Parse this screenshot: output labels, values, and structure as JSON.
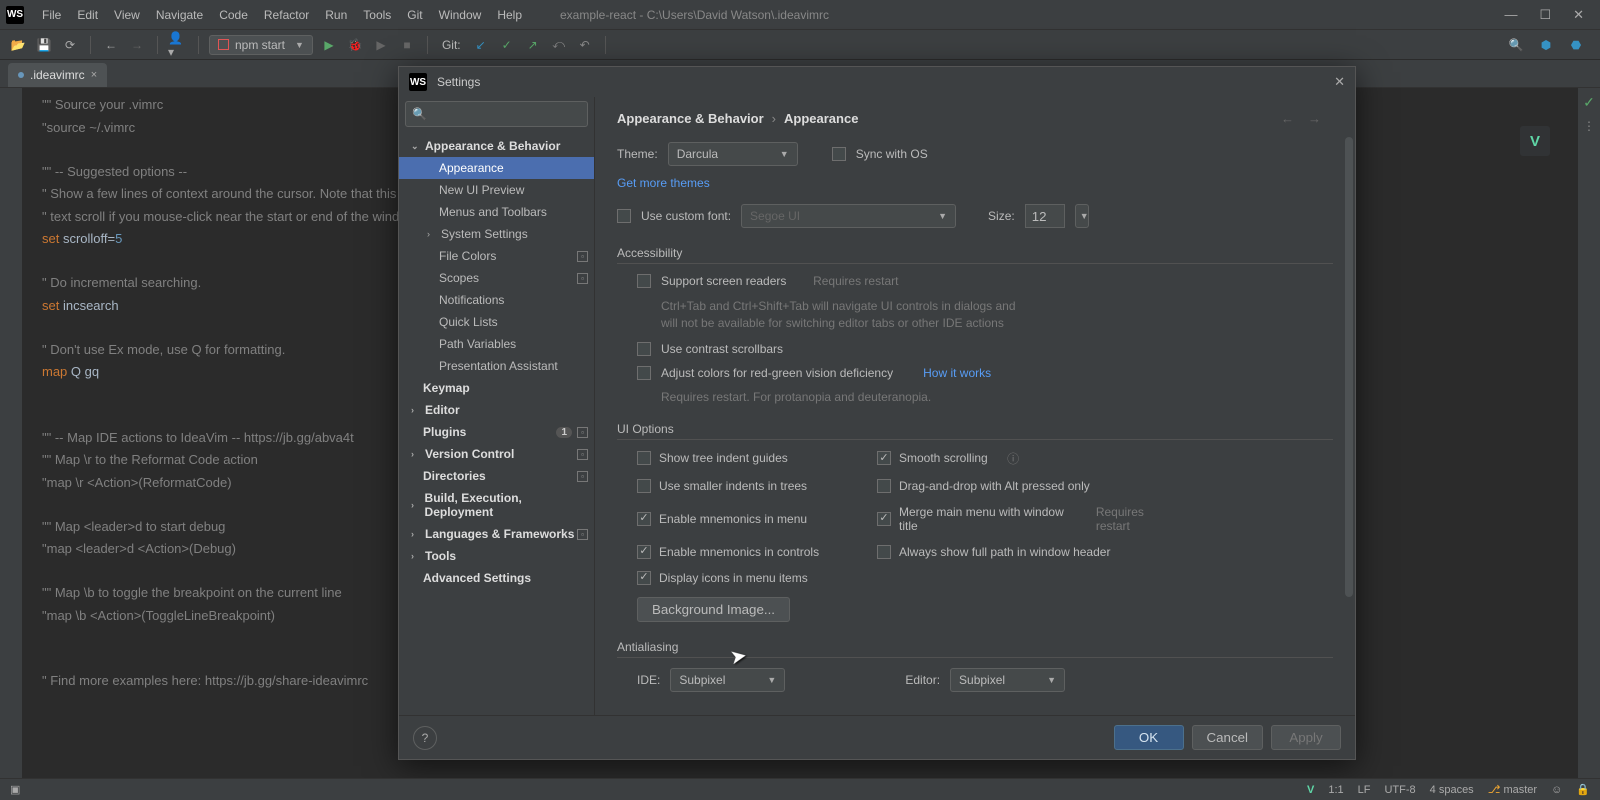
{
  "title": {
    "project": "example-react",
    "path": "C:\\Users\\David Watson\\.ideavimrc"
  },
  "menu": [
    "File",
    "Edit",
    "View",
    "Navigate",
    "Code",
    "Refactor",
    "Run",
    "Tools",
    "Git",
    "Window",
    "Help"
  ],
  "runconfig": "npm start",
  "git_label": "Git:",
  "tab_name": ".ideavimrc",
  "code": {
    "l1": "\"\" Source your .vimrc",
    "l2": "\"source ~/.vimrc",
    "l3": "\"\" -- Suggested options --",
    "l4": "\" Show a few lines of context around the cursor. Note that this makes the",
    "l5": "\" text scroll if you mouse-click near the start or end of the window.",
    "l6a": "set",
    "l6b": " scrolloff=",
    "l6c": "5",
    "l7": "\" Do incremental searching.",
    "l8a": "set",
    "l8b": " incsearch",
    "l9": "\" Don't use Ex mode, use Q for formatting.",
    "l10a": "map ",
    "l10b": "Q gq",
    "l11": "\"\" -- Map IDE actions to IdeaVim -- https://jb.gg/abva4t",
    "l12": "\"\" Map \\r to the Reformat Code action",
    "l13": "\"map \\r <Action>(ReformatCode)",
    "l14": "\"\" Map <leader>d to start debug",
    "l15": "\"map <leader>d <Action>(Debug)",
    "l16": "\"\" Map \\b to toggle the breakpoint on the current line",
    "l17": "\"map \\b <Action>(ToggleLineBreakpoint)",
    "l18": "\" Find more examples here: https://jb.gg/share-ideavimrc"
  },
  "dialog": {
    "title": "Settings",
    "tree": {
      "appearance_behavior": "Appearance & Behavior",
      "appearance": "Appearance",
      "new_ui": "New UI Preview",
      "menus": "Menus and Toolbars",
      "system": "System Settings",
      "file_colors": "File Colors",
      "scopes": "Scopes",
      "notifications": "Notifications",
      "quick_lists": "Quick Lists",
      "path_vars": "Path Variables",
      "presentation": "Presentation Assistant",
      "keymap": "Keymap",
      "editor": "Editor",
      "plugins": "Plugins",
      "vc": "Version Control",
      "dirs": "Directories",
      "build": "Build, Execution, Deployment",
      "lang": "Languages & Frameworks",
      "tools": "Tools",
      "advanced": "Advanced Settings",
      "plugin_count": "1"
    },
    "breadcrumb": {
      "a": "Appearance & Behavior",
      "b": "Appearance"
    },
    "theme_label": "Theme:",
    "theme_value": "Darcula",
    "sync_os": "Sync with OS",
    "more_themes": "Get more themes",
    "custom_font_label": "Use custom font:",
    "custom_font_value": "Segoe UI",
    "size_label": "Size:",
    "size_value": "12",
    "accessibility": "Accessibility",
    "screen_readers": "Support screen readers",
    "requires_restart": "Requires restart",
    "sr_help": "Ctrl+Tab and Ctrl+Shift+Tab will navigate UI controls in dialogs and will not be available for switching editor tabs or other IDE actions",
    "contrast": "Use contrast scrollbars",
    "color_def": "Adjust colors for red-green vision deficiency",
    "how_works": "How it works",
    "color_def_help": "Requires restart. For protanopia and deuteranopia.",
    "ui_options": "UI Options",
    "opts": {
      "tree_indent": "Show tree indent guides",
      "smooth": "Smooth scrolling",
      "smaller_indent": "Use smaller indents in trees",
      "drag_alt": "Drag-and-drop with Alt pressed only",
      "mnem_menu": "Enable mnemonics in menu",
      "merge_menu": "Merge main menu with window title",
      "mnem_ctrl": "Enable mnemonics in controls",
      "full_path": "Always show full path in window header",
      "icons_menu": "Display icons in menu items"
    },
    "bg_image": "Background Image...",
    "antialiasing": "Antialiasing",
    "ide_label": "IDE:",
    "ide_value": "Subpixel",
    "editor_label": "Editor:",
    "editor_value": "Subpixel",
    "ok": "OK",
    "cancel": "Cancel",
    "apply": "Apply"
  },
  "status": {
    "pos": "1:1",
    "lf": "LF",
    "enc": "UTF-8",
    "indent": "4 spaces",
    "branch": "master"
  }
}
